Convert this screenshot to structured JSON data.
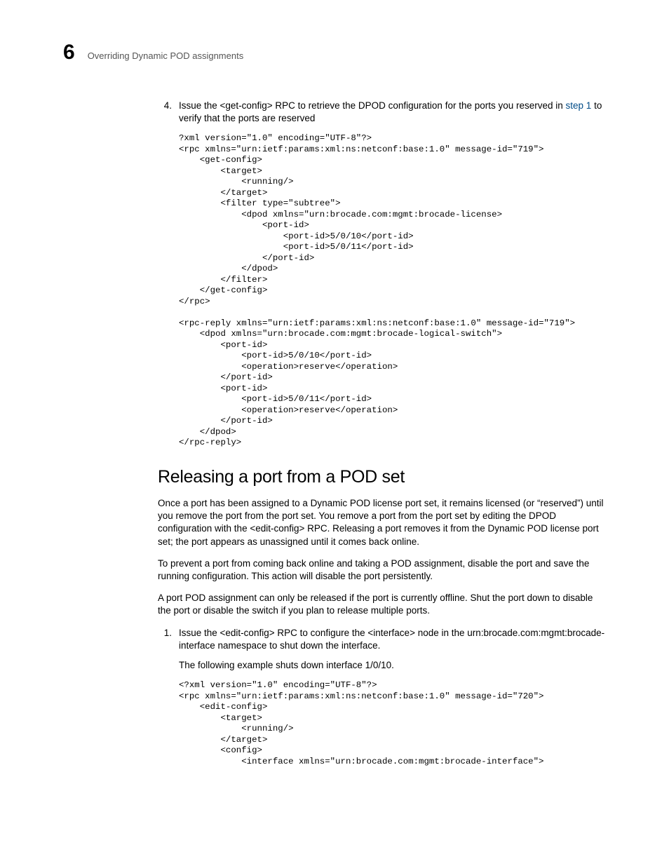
{
  "header": {
    "chapter_number": "6",
    "running_title": "Overriding Dynamic POD assignments"
  },
  "step4": {
    "number": "4.",
    "text_before_link": "Issue the <get-config> RPC to retrieve the DPOD configuration for the ports you reserved in ",
    "link_text": "step 1",
    "text_after_link": " to verify that the ports are reserved"
  },
  "code_block_1": "?xml version=\"1.0\" encoding=\"UTF-8\"?>\n<rpc xmlns=\"urn:ietf:params:xml:ns:netconf:base:1.0\" message-id=\"719\">\n    <get-config>\n        <target>\n            <running/>\n        </target>\n        <filter type=\"subtree\">\n            <dpod xmlns=\"urn:brocade.com:mgmt:brocade-license>\n                <port-id>\n                    <port-id>5/0/10</port-id>\n                    <port-id>5/0/11</port-id>\n                </port-id>\n            </dpod>\n        </filter>\n    </get-config>\n</rpc>\n\n<rpc-reply xmlns=\"urn:ietf:params:xml:ns:netconf:base:1.0\" message-id=\"719\">\n    <dpod xmlns=\"urn:brocade.com:mgmt:brocade-logical-switch\">\n        <port-id>\n            <port-id>5/0/10</port-id>\n            <operation>reserve</operation>\n        </port-id>\n        <port-id>\n            <port-id>5/0/11</port-id>\n            <operation>reserve</operation>\n        </port-id>\n    </dpod>\n</rpc-reply>",
  "section": {
    "title": "Releasing a port from a POD set",
    "para1": "Once a port has been assigned to a Dynamic POD license port set, it remains licensed (or “reserved”) until you remove the port from the port set. You remove a port from the port set by editing the DPOD configuration with the <edit-config> RPC. Releasing a port removes it from the Dynamic POD license port set; the port appears as unassigned until it comes back online.",
    "para2": "To prevent a port from coming back online and taking a POD assignment, disable the port and save the running configuration. This action will disable the port persistently.",
    "para3": "A port POD assignment can only be released if the port is currently offline. Shut the port down to disable the port or disable the switch if you plan to release multiple ports."
  },
  "step1": {
    "number": "1.",
    "text": "Issue the <edit-config> RPC to configure the <interface> node in the urn:brocade.com:mgmt:brocade-interface namespace to shut down the interface.",
    "subtext": "The following example shuts down interface 1/0/10."
  },
  "code_block_2": "<?xml version=\"1.0\" encoding=\"UTF-8\"?>\n<rpc xmlns=\"urn:ietf:params:xml:ns:netconf:base:1.0\" message-id=\"720\">\n    <edit-config>\n        <target>\n            <running/>\n        </target>\n        <config>\n            <interface xmlns=\"urn:brocade.com:mgmt:brocade-interface\">"
}
